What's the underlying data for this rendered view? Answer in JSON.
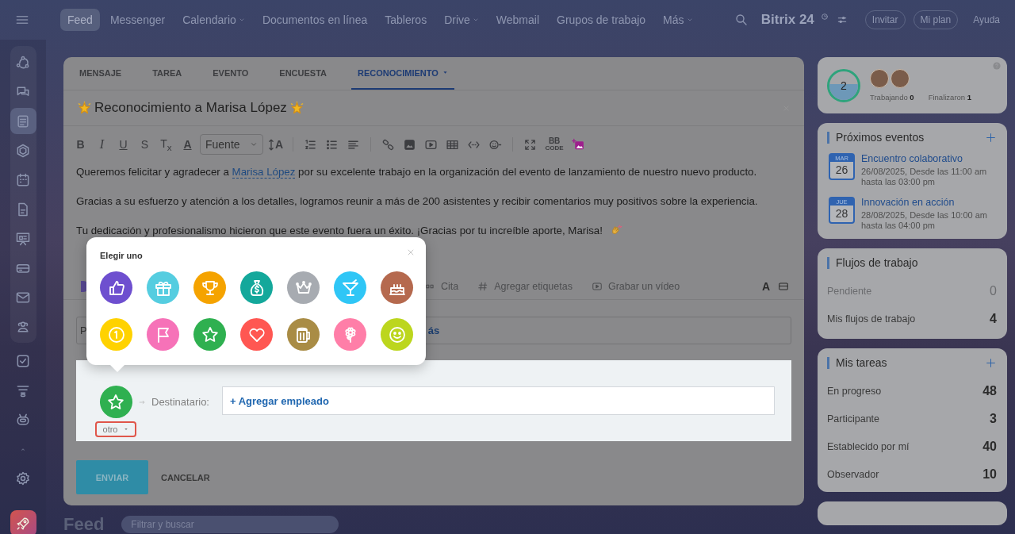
{
  "top_bar": {
    "nav": [
      {
        "label": "Feed",
        "selected": true,
        "dropdown": false
      },
      {
        "label": "Messenger",
        "selected": false,
        "dropdown": false
      },
      {
        "label": "Calendario",
        "selected": false,
        "dropdown": true
      },
      {
        "label": "Documentos en línea",
        "selected": false,
        "dropdown": false
      },
      {
        "label": "Tableros",
        "selected": false,
        "dropdown": false
      },
      {
        "label": "Drive",
        "selected": false,
        "dropdown": true
      },
      {
        "label": "Webmail",
        "selected": false,
        "dropdown": false
      },
      {
        "label": "Grupos de trabajo",
        "selected": false,
        "dropdown": false
      },
      {
        "label": "Más",
        "selected": false,
        "dropdown": true
      }
    ],
    "logo": "Bitrix 24",
    "buttons": [
      "Invitar",
      "Mi plan",
      "Ayuda"
    ]
  },
  "sidebar": {
    "items": [
      {
        "kind": "activity",
        "selected": false
      },
      {
        "kind": "chat",
        "selected": false
      },
      {
        "kind": "feed",
        "selected": true
      },
      {
        "kind": "hexagon",
        "selected": false
      },
      {
        "kind": "calendar",
        "selected": false
      },
      {
        "kind": "document",
        "selected": false
      },
      {
        "kind": "board",
        "selected": false
      },
      {
        "kind": "drive",
        "selected": false
      },
      {
        "kind": "mail",
        "selected": false
      },
      {
        "kind": "people",
        "selected": false
      },
      {
        "kind": "tasks",
        "selected": false
      },
      {
        "kind": "funnel",
        "selected": false
      },
      {
        "kind": "robot",
        "selected": false
      },
      {
        "kind": "more",
        "selected": false
      },
      {
        "kind": "settings",
        "selected": false
      }
    ]
  },
  "composer": {
    "tabs": [
      {
        "label": "MENSAJE",
        "selected": false,
        "dropdown": false
      },
      {
        "label": "TAREA",
        "selected": false,
        "dropdown": false
      },
      {
        "label": "EVENTO",
        "selected": false,
        "dropdown": false
      },
      {
        "label": "ENCUESTA",
        "selected": false,
        "dropdown": false
      },
      {
        "label": "RECONOCIMIENTO",
        "selected": true,
        "dropdown": true
      }
    ],
    "title": "Reconocimiento a Marisa López",
    "toolbar": [
      {
        "kind": "bold",
        "label": "B"
      },
      {
        "kind": "italic",
        "label": "I"
      },
      {
        "kind": "underline",
        "label": "U"
      },
      {
        "kind": "strike",
        "label": "S"
      },
      {
        "kind": "clear",
        "label": "T$_{x}$"
      },
      {
        "kind": "color",
        "label": "A"
      },
      {
        "kind": "select",
        "label": "Fuente"
      },
      {
        "kind": "size",
        "label": "A"
      },
      {
        "kind": "sep"
      },
      {
        "kind": "ordered-list"
      },
      {
        "kind": "bullet-list"
      },
      {
        "kind": "align"
      },
      {
        "kind": "sep"
      },
      {
        "kind": "link"
      },
      {
        "kind": "image"
      },
      {
        "kind": "video"
      },
      {
        "kind": "table"
      },
      {
        "kind": "code"
      },
      {
        "kind": "emoji"
      },
      {
        "kind": "sep"
      },
      {
        "kind": "fullscreen"
      },
      {
        "kind": "bbcode",
        "label": "BB",
        "sublabel": "CODE"
      },
      {
        "kind": "ai-image"
      }
    ],
    "paragraphs": [
      {
        "before": "Queremos felicitar y agradecer a ",
        "link": "Marisa López",
        "after": " por su excelente trabajo en la organización del evento de lanzamiento de nuestro nuevo producto.",
        "emoji": false
      },
      {
        "before": "Gracias a su esfuerzo y atención a los detalles, logramos reunir a más de 200 asistentes y recibir comentarios muy positivos sobre la experiencia.",
        "emoji": false
      },
      {
        "before": "Tu dedicación y profesionalismo hicieron que este evento fuera un éxito. ¡Gracias por tu increíble aporte, Marisa!",
        "emoji": true
      }
    ],
    "actions": [
      {
        "kind": "quote",
        "label": "Cita"
      },
      {
        "kind": "tag",
        "label": "Agregar etiquetas"
      },
      {
        "kind": "video",
        "label": "Grabar un vídeo"
      }
    ],
    "format_toggle": "A",
    "field": {
      "prefix": "P",
      "link_fragment": "ás"
    },
    "badge_picker": {
      "title": "Elegir uno",
      "badges": [
        {
          "kind": "thumb",
          "color": "#6e4fcf"
        },
        {
          "kind": "gift",
          "color": "#55cde0"
        },
        {
          "kind": "trophy",
          "color": "#f5a300"
        },
        {
          "kind": "money",
          "color": "#14a89b"
        },
        {
          "kind": "crown",
          "color": "#a7abb1"
        },
        {
          "kind": "cocktail",
          "color": "#2fc6f6"
        },
        {
          "kind": "cake",
          "color": "#b5694e"
        },
        {
          "kind": "coin",
          "color": "#ffd200"
        },
        {
          "kind": "flag",
          "color": "#f672b8"
        },
        {
          "kind": "star",
          "color": "#2fb050"
        },
        {
          "kind": "heart",
          "color": "#ff5752"
        },
        {
          "kind": "beer",
          "color": "#a98c45"
        },
        {
          "kind": "flower",
          "color": "#ff7ea8"
        },
        {
          "kind": "smile",
          "color": "#bcd61e"
        }
      ]
    },
    "recipient": {
      "badge": {
        "kind": "star",
        "color": "#2fb050"
      },
      "badge_name": "otro",
      "label": "Destinatario:",
      "add_link": "+ Agregar empleado"
    },
    "buttons": [
      {
        "kind": "primary",
        "label": "ENVIAR"
      },
      {
        "kind": "link",
        "label": "CANCELAR"
      }
    ]
  },
  "feed": {
    "title": "Feed",
    "filter_placeholder": "Filtrar y buscar"
  },
  "widgets": {
    "presence": {
      "count": "2",
      "stats": [
        {
          "label": "Trabajando",
          "value": "0"
        },
        {
          "label": "Finalizaron",
          "value": "1"
        }
      ]
    },
    "events": {
      "title": "Próximos eventos",
      "items": [
        {
          "month": "MAR",
          "day": "26",
          "title": "Encuentro colaborativo",
          "line1": "26/08/2025, Desde las 11:00 am",
          "line2": "hasta las 03:00 pm"
        },
        {
          "month": "JUE",
          "day": "28",
          "title": "Innovación en acción",
          "line1": "28/08/2025, Desde las 10:00 am",
          "line2": "hasta las 04:00 pm"
        }
      ]
    },
    "workflows": {
      "title": "Flujos de trabajo",
      "add": false,
      "rows": [
        {
          "label": "Pendiente",
          "value": "0",
          "muted": true
        },
        {
          "label": "Mis flujos de trabajo",
          "value": "4",
          "muted": false
        }
      ]
    },
    "tasks": {
      "title": "Mis tareas",
      "add": true,
      "rows": [
        {
          "label": "En progreso",
          "value": "48",
          "muted": false
        },
        {
          "label": "Participante",
          "value": "3",
          "muted": false
        },
        {
          "label": "Establecido por mí",
          "value": "40",
          "muted": false
        },
        {
          "label": "Observador",
          "value": "10",
          "muted": false
        }
      ]
    }
  }
}
